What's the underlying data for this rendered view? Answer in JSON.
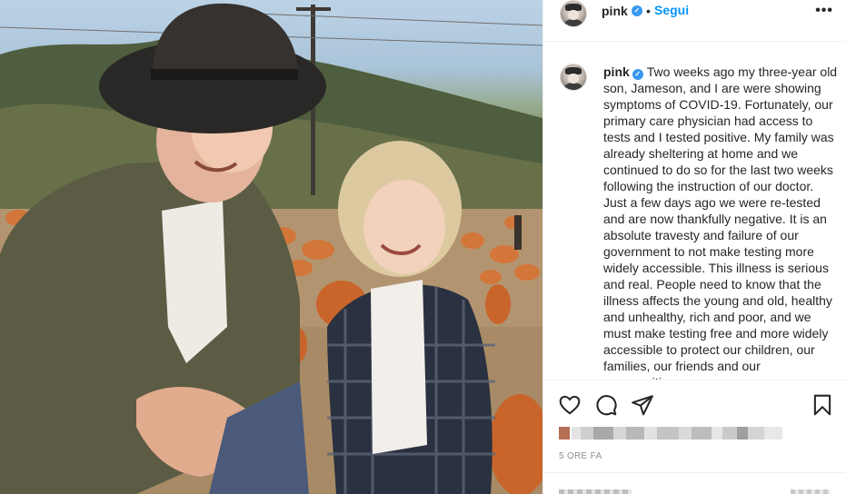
{
  "post": {
    "username": "pink",
    "verified_icon": "verified-badge-icon",
    "separator": "•",
    "follow_label": "Segui",
    "more_label": "•••",
    "caption": "Two weeks ago my three-year old son, Jameson, and I are were showing symptoms of COVID-19. Fortunately, our primary care physician had access to tests and I tested positive. My family was already sheltering at home and we continued to do so for the last two weeks following the instruction of our doctor. Just a few days ago we were re-tested and are now thankfully negative. It is an absolute travesty and failure of our government to not make testing more widely accessible. This illness is serious and real. People need to know that the illness affects the young and old, healthy and unhealthy, rich and poor, and we must make testing free and more widely accessible to protect our children, our families, our friends and our communities.",
    "timestamp": "5 ORE FA"
  },
  "actions": {
    "like_icon": "heart-icon",
    "comment_icon": "comment-icon",
    "share_icon": "share-icon",
    "save_icon": "bookmark-icon"
  },
  "colors": {
    "accent": "#0095f6",
    "verified": "#3897f0",
    "text": "#262626",
    "muted": "#8e8e8e",
    "border": "#efefef"
  }
}
